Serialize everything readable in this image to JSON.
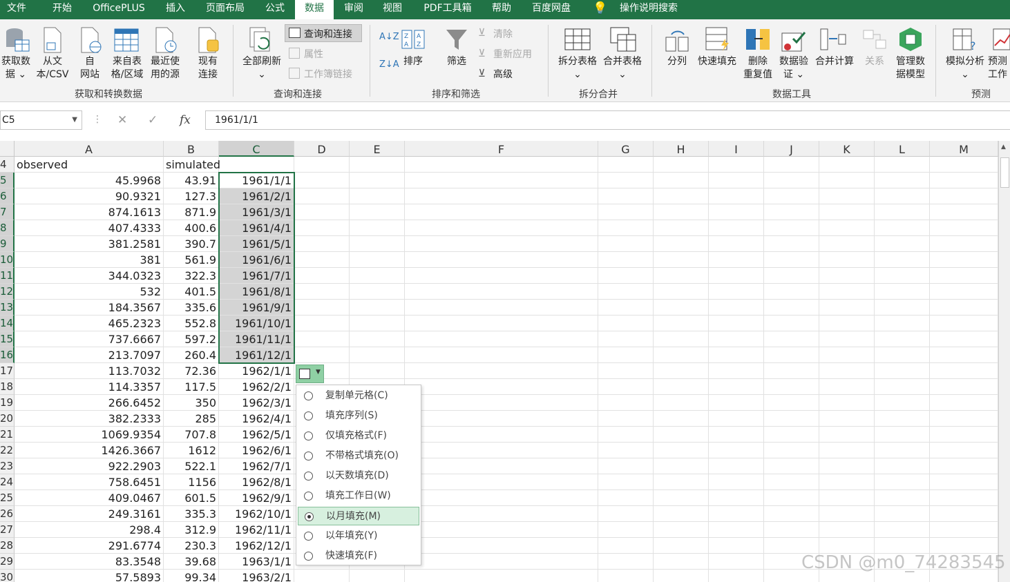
{
  "tabs": [
    "文件",
    "开始",
    "OfficePLUS",
    "插入",
    "页面布局",
    "公式",
    "数据",
    "审阅",
    "视图",
    "PDF工具箱",
    "帮助",
    "百度网盘",
    "操作说明搜索"
  ],
  "active_tab": "数据",
  "ribbon": {
    "get_data": {
      "l1": "获取数",
      "l2": "据 ⌄"
    },
    "from_text": {
      "l1": "从文",
      "l2": "本/CSV"
    },
    "from_web": {
      "l1": "自",
      "l2": "网站"
    },
    "from_table": {
      "l1": "来自表",
      "l2": "格/区域"
    },
    "recent": {
      "l1": "最近使",
      "l2": "用的源"
    },
    "existing": {
      "l1": "现有",
      "l2": "连接"
    },
    "group1": "获取和转换数据",
    "refresh_all": {
      "l1": "全部刷新",
      "l2": "⌄"
    },
    "queries_connections": "查询和连接",
    "properties": "属性",
    "edit_links": "工作簿链接",
    "group2": "查询和连接",
    "sort": "排序",
    "filter": "筛选",
    "clear": "清除",
    "reapply": "重新应用",
    "advanced": "高级",
    "group3": "排序和筛选",
    "split_table": {
      "l1": "拆分表格",
      "l2": "⌄"
    },
    "merge_table": {
      "l1": "合并表格",
      "l2": "⌄"
    },
    "group4": "拆分合并",
    "text_to_columns": "分列",
    "flash_fill": "快速填充",
    "remove_dup": {
      "l1": "删除",
      "l2": "重复值"
    },
    "validation": {
      "l1": "数据验",
      "l2": "证 ⌄"
    },
    "consolidate": "合并计算",
    "relationships": "关系",
    "data_model": {
      "l1": "管理数",
      "l2": "据模型"
    },
    "group5": "数据工具",
    "what_if": {
      "l1": "模拟分析",
      "l2": "⌄"
    },
    "forecast": {
      "l1": "预测",
      "l2": "工作"
    },
    "group6": "预测"
  },
  "formula_bar": {
    "name_box": "C5",
    "cancel": "✕",
    "enter": "✓",
    "fx": "fx",
    "value": "1961/1/1"
  },
  "columns": [
    "A",
    "B",
    "C",
    "D",
    "E",
    "F",
    "G",
    "H",
    "I",
    "J",
    "K",
    "L",
    "M"
  ],
  "rows": [
    {
      "n": "4",
      "a": "observed",
      "b": "simulated",
      "c": ""
    },
    {
      "n": "5",
      "a": "45.9968",
      "b": "43.91",
      "c": "1961/1/1"
    },
    {
      "n": "6",
      "a": "90.9321",
      "b": "127.3",
      "c": "1961/2/1"
    },
    {
      "n": "7",
      "a": "874.1613",
      "b": "871.9",
      "c": "1961/3/1"
    },
    {
      "n": "8",
      "a": "407.4333",
      "b": "400.6",
      "c": "1961/4/1"
    },
    {
      "n": "9",
      "a": "381.2581",
      "b": "390.7",
      "c": "1961/5/1"
    },
    {
      "n": "10",
      "a": "381",
      "b": "561.9",
      "c": "1961/6/1"
    },
    {
      "n": "11",
      "a": "344.0323",
      "b": "322.3",
      "c": "1961/7/1"
    },
    {
      "n": "12",
      "a": "532",
      "b": "401.5",
      "c": "1961/8/1"
    },
    {
      "n": "13",
      "a": "184.3567",
      "b": "335.6",
      "c": "1961/9/1"
    },
    {
      "n": "14",
      "a": "465.2323",
      "b": "552.8",
      "c": "1961/10/1"
    },
    {
      "n": "15",
      "a": "737.6667",
      "b": "597.2",
      "c": "1961/11/1"
    },
    {
      "n": "16",
      "a": "213.7097",
      "b": "260.4",
      "c": "1961/12/1"
    },
    {
      "n": "17",
      "a": "113.7032",
      "b": "72.36",
      "c": "1962/1/1"
    },
    {
      "n": "18",
      "a": "114.3357",
      "b": "117.5",
      "c": "1962/2/1"
    },
    {
      "n": "19",
      "a": "266.6452",
      "b": "350",
      "c": "1962/3/1"
    },
    {
      "n": "20",
      "a": "382.2333",
      "b": "285",
      "c": "1962/4/1"
    },
    {
      "n": "21",
      "a": "1069.9354",
      "b": "707.8",
      "c": "1962/5/1"
    },
    {
      "n": "22",
      "a": "1426.3667",
      "b": "1612",
      "c": "1962/6/1"
    },
    {
      "n": "23",
      "a": "922.2903",
      "b": "522.1",
      "c": "1962/7/1"
    },
    {
      "n": "24",
      "a": "758.6451",
      "b": "1156",
      "c": "1962/8/1"
    },
    {
      "n": "25",
      "a": "409.0467",
      "b": "601.5",
      "c": "1962/9/1"
    },
    {
      "n": "26",
      "a": "249.3161",
      "b": "335.3",
      "c": "1962/10/1"
    },
    {
      "n": "27",
      "a": "298.4",
      "b": "312.9",
      "c": "1962/11/1"
    },
    {
      "n": "28",
      "a": "291.6774",
      "b": "230.3",
      "c": "1962/12/1"
    },
    {
      "n": "29",
      "a": "83.3548",
      "b": "39.68",
      "c": "1963/1/1"
    },
    {
      "n": "30",
      "a": "57.5893",
      "b": "99.34",
      "c": "1963/2/1"
    }
  ],
  "autofill_options": [
    {
      "label": "复制单元格(C)",
      "selected": false
    },
    {
      "label": "填充序列(S)",
      "selected": false
    },
    {
      "label": "仅填充格式(F)",
      "selected": false
    },
    {
      "label": "不带格式填充(O)",
      "selected": false
    },
    {
      "label": "以天数填充(D)",
      "selected": false
    },
    {
      "label": "填充工作日(W)",
      "selected": false
    },
    {
      "label": "以月填充(M)",
      "selected": true
    },
    {
      "label": "以年填充(Y)",
      "selected": false
    },
    {
      "label": "快速填充(F)",
      "selected": false
    }
  ],
  "watermark": "CSDN @m0_74283545",
  "colors": {
    "accent": "#217346",
    "selection_fill": "#d4d4d4",
    "menu_selected": "#d7f0df"
  }
}
